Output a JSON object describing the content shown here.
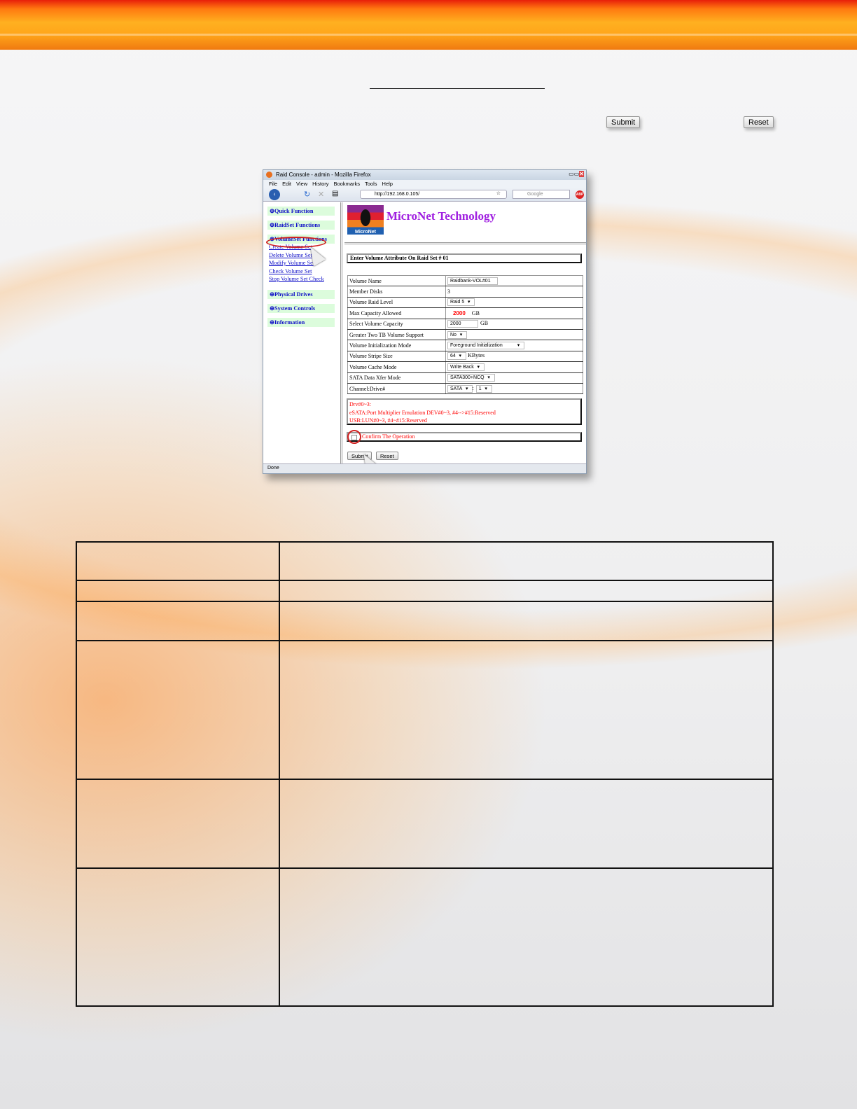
{
  "page": {
    "top_submit_label": "Submit",
    "top_reset_label": "Reset"
  },
  "browser": {
    "title": "Raid Console - admin - Mozilla Firefox",
    "menu": [
      "File",
      "Edit",
      "View",
      "History",
      "Bookmarks",
      "Tools",
      "Help"
    ],
    "url": "http://192.168.0.105/",
    "search_placeholder": "Google",
    "status": "Done"
  },
  "sidebar": {
    "quick_function": "Quick Function",
    "raidset_functions": "RaidSet Functions",
    "volumeset_functions": "VolumeSet Functions",
    "links": [
      "Create Volume Set",
      "Delete Volume Set",
      "Modify Volume Set",
      "Check Volume Set",
      "Stop Volume Set Check"
    ],
    "physical_drives": "Physical Drives",
    "system_controls": "System Controls",
    "information": "Information"
  },
  "main": {
    "logo_text": "MicroNet",
    "brand": "MicroNet Technology",
    "heading": "Enter Volume Attribute On Raid Set # 01",
    "fields": [
      {
        "label": "Volume Name",
        "value": "Raidbank-VOL#01"
      },
      {
        "label": "Member Disks",
        "value": "3"
      },
      {
        "label": "Volume Raid Level",
        "value": "Raid 5"
      },
      {
        "label": "Max Capacity Allowed",
        "value": "2000",
        "unit": "GB"
      },
      {
        "label": "Select Volume Capacity",
        "value": "2000",
        "unit": "GB"
      },
      {
        "label": "Greater Two TB Volume Support",
        "value": "No"
      },
      {
        "label": "Volume Initialization Mode",
        "value": "Foreground Initialization"
      },
      {
        "label": "Volume Stripe Size",
        "value": "64",
        "unit": "KBytes"
      },
      {
        "label": "Volume Cache Mode",
        "value": "Write Back"
      },
      {
        "label": "SATA Data Xfer Mode",
        "value": "SATA300+NCQ"
      },
      {
        "label": "Channel:Drive#",
        "value": "SATA",
        "value2": "1",
        "sep": ":"
      }
    ],
    "notes": [
      "Drv#0~3:",
      "eSATA:Port Multiplier Emulation DEV#0~3, #4-->#15:Reserved",
      "USB:LUN#0~3, #4~#15:Reserved"
    ],
    "confirm_label": "Confirm The Operation",
    "submit_label": "Submit",
    "reset_label": "Reset"
  },
  "colors": {
    "accent": "#ff9a10",
    "link": "#1010c8",
    "brand": "#a020e0",
    "warning": "#ff0000"
  }
}
